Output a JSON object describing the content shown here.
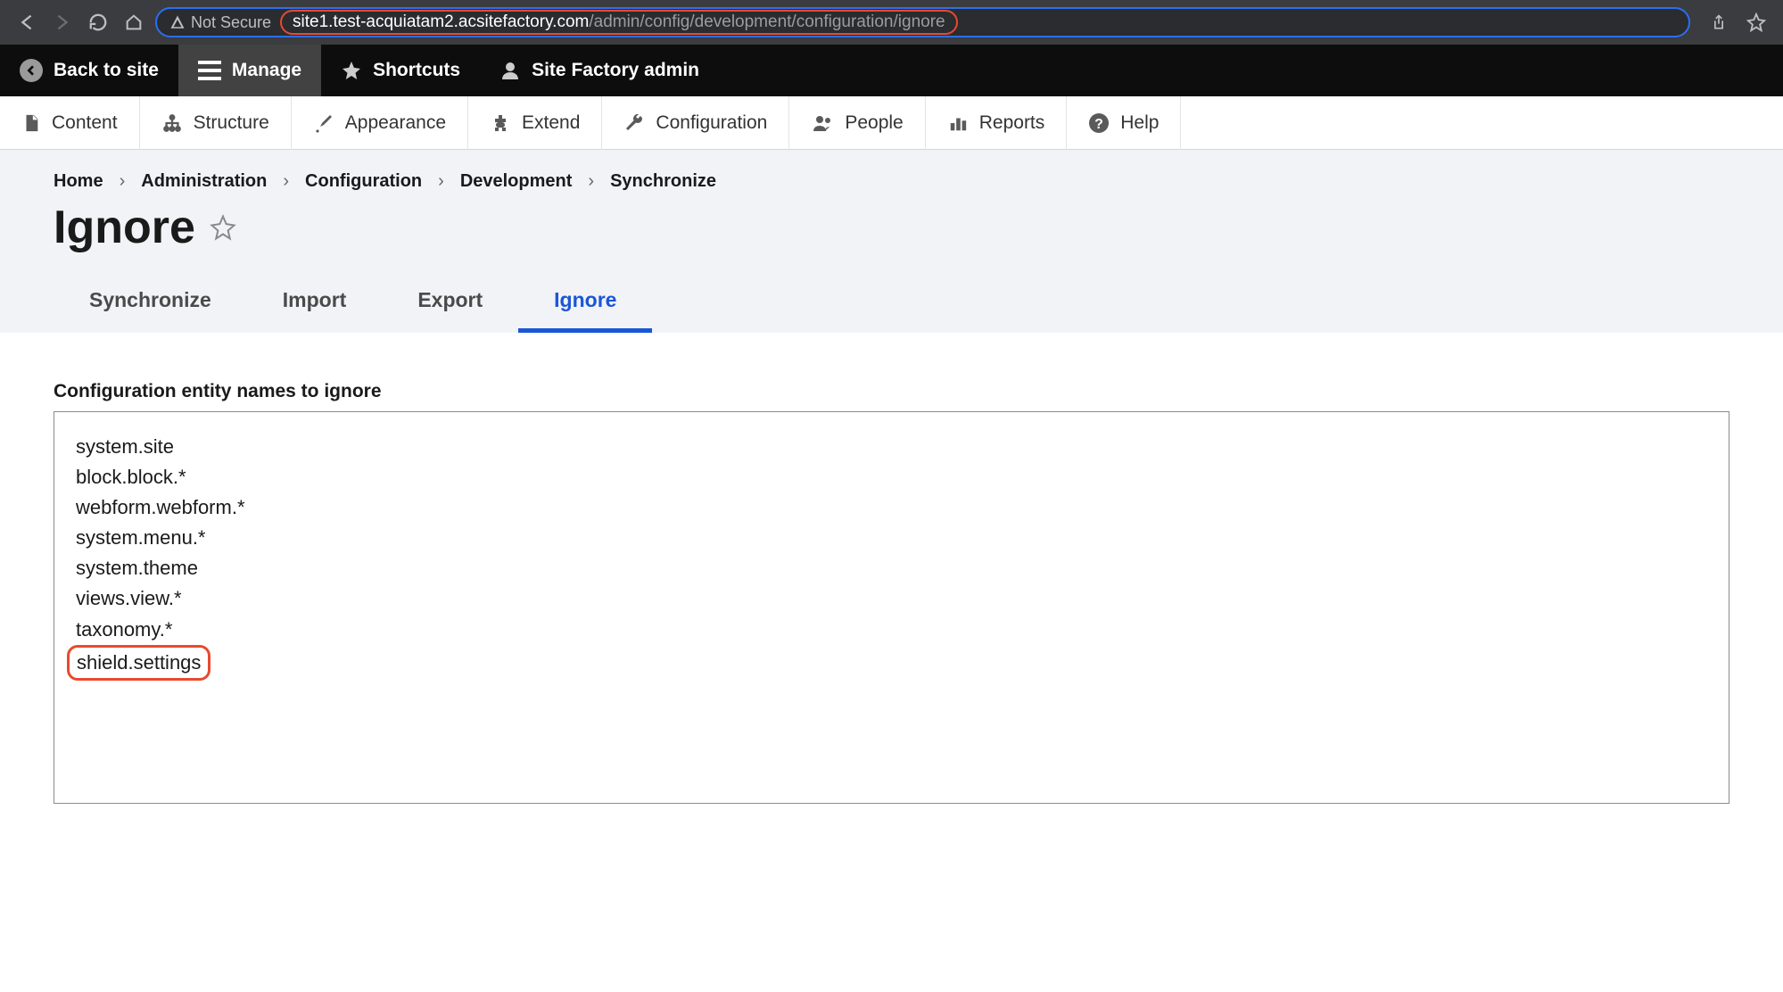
{
  "browser": {
    "secure_label": "Not Secure",
    "url_domain": "site1.test-acquiatam2.acsitefactory.com",
    "url_path": "/admin/config/development/configuration/ignore"
  },
  "toolbar": {
    "back_to_site": "Back to site",
    "manage": "Manage",
    "shortcuts": "Shortcuts",
    "user": "Site Factory admin"
  },
  "secondary_nav": [
    {
      "id": "content",
      "label": "Content"
    },
    {
      "id": "structure",
      "label": "Structure"
    },
    {
      "id": "appearance",
      "label": "Appearance"
    },
    {
      "id": "extend",
      "label": "Extend"
    },
    {
      "id": "configuration",
      "label": "Configuration"
    },
    {
      "id": "people",
      "label": "People"
    },
    {
      "id": "reports",
      "label": "Reports"
    },
    {
      "id": "help",
      "label": "Help"
    }
  ],
  "breadcrumbs": [
    "Home",
    "Administration",
    "Configuration",
    "Development",
    "Synchronize"
  ],
  "page_title": "Ignore",
  "tabs": [
    {
      "label": "Synchronize",
      "active": false
    },
    {
      "label": "Import",
      "active": false
    },
    {
      "label": "Export",
      "active": false
    },
    {
      "label": "Ignore",
      "active": true
    }
  ],
  "form": {
    "field_label": "Configuration entity names to ignore",
    "lines": [
      "system.site",
      "block.block.*",
      "webform.webform.*",
      "system.menu.*",
      "system.theme",
      "views.view.*",
      "taxonomy.*",
      "shield.settings"
    ],
    "highlighted_line_index": 7
  }
}
